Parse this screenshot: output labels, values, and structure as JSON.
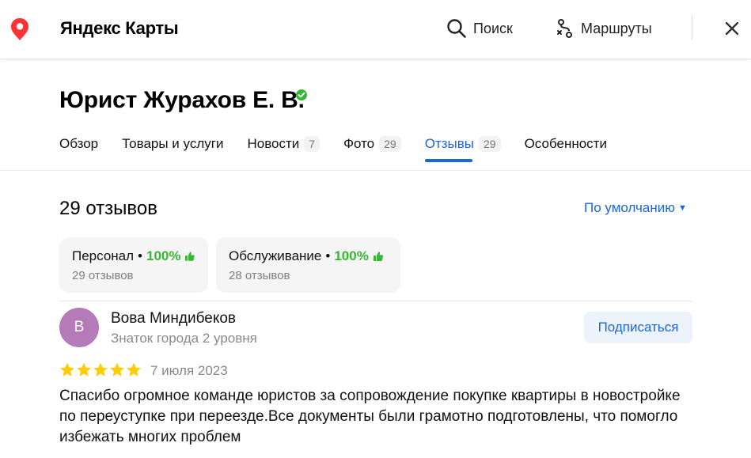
{
  "header": {
    "logo_text": "Яндекс Карты",
    "search_label": "Поиск",
    "routes_label": "Маршруты"
  },
  "org": {
    "title": "Юрист Журахов Е. В."
  },
  "tabs": [
    {
      "label": "Обзор",
      "count": ""
    },
    {
      "label": "Товары и услуги",
      "count": ""
    },
    {
      "label": "Новости",
      "count": "7"
    },
    {
      "label": "Фото",
      "count": "29"
    },
    {
      "label": "Отзывы",
      "count": "29",
      "active": true
    },
    {
      "label": "Особенности",
      "count": ""
    }
  ],
  "reviews": {
    "total_label": "29 отзывов",
    "sort_label": "По умолчанию",
    "aspects": [
      {
        "name": "Персонал",
        "percent": "100%",
        "count_label": "29 отзывов"
      },
      {
        "name": "Обслуживание",
        "percent": "100%",
        "count_label": "28 отзывов"
      }
    ],
    "items": [
      {
        "avatar_letter": "В",
        "author": "Вова Миндибеков",
        "level": "Знаток города 2 уровня",
        "subscribe_label": "Подписаться",
        "rating": 5,
        "date": "7 июля 2023",
        "text": "Спасибо огромное команде юристов за сопровождение покупке квартиры в новостройке по переуступке при переезде.Все документы были грамотно подготовлены, что помогло избежать многих проблем"
      }
    ]
  },
  "colors": {
    "accent": "#1a66e0",
    "positive": "#3bb536",
    "star": "#fc0",
    "avatar": "#b57bb9",
    "logo_pin": "#f33"
  },
  "icons": {
    "logo": "map-pin-icon",
    "search": "search-icon",
    "routes": "route-icon",
    "close": "close-icon",
    "verified": "verified-check-icon",
    "thumb": "thumbs-up-icon",
    "star": "star-icon"
  }
}
